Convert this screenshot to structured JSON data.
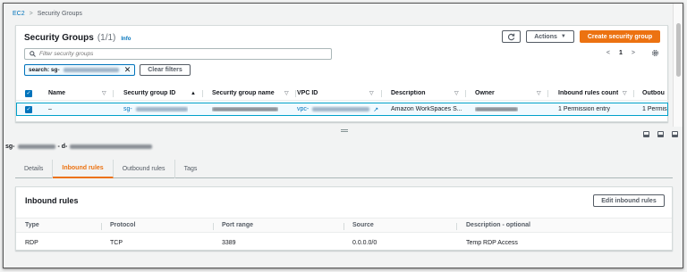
{
  "breadcrumb": {
    "root": "EC2",
    "sep": ">",
    "current": "Security Groups"
  },
  "top_panel": {
    "title": "Security Groups",
    "count": "(1/1)",
    "info": "Info",
    "refresh_icon": "refresh-icon",
    "actions_label": "Actions",
    "create_label": "Create security group",
    "search_placeholder": "Filter security groups",
    "filter_token_label": "search: sg-",
    "clear_filters_label": "Clear filters",
    "page_number": "1",
    "prev": "<",
    "next": ">",
    "settings_icon": "gear-icon"
  },
  "table": {
    "columns": [
      "Name",
      "Security group ID",
      "Security group name",
      "VPC ID",
      "Description",
      "Owner",
      "Inbound rules count",
      "Outbou"
    ],
    "row": {
      "name": "–",
      "sg_id_prefix": "sg-",
      "vpc_prefix": "vpc-",
      "description": "Amazon WorkSpaces S...",
      "inbound_count": "1 Permission entry",
      "outbound_count": "1 Permis"
    }
  },
  "detail": {
    "title_prefix": "sg-",
    "title_mid": " - d-",
    "tabs": [
      "Details",
      "Inbound rules",
      "Outbound rules",
      "Tags"
    ],
    "active_tab": "Inbound rules"
  },
  "inbound": {
    "title": "Inbound rules",
    "edit_label": "Edit inbound rules",
    "columns": [
      "Type",
      "Protocol",
      "Port range",
      "Source",
      "Description - optional"
    ],
    "rows": [
      {
        "type": "RDP",
        "protocol": "TCP",
        "port_range": "3389",
        "source": "0.0.0.0/0",
        "description": "Temp RDP Access"
      }
    ]
  },
  "colors": {
    "accent": "#ec7211",
    "link": "#0073bb",
    "selected_row": "#f1faff"
  }
}
